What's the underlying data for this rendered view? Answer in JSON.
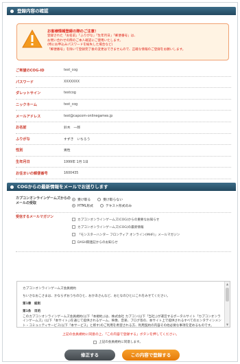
{
  "confirm_section": {
    "title": "登録内容の確認"
  },
  "warning": {
    "title": "お客様情報登録の際のご注意！",
    "lines": [
      "登録された「お名前」「ふりがな」「生年月日」「郵便番号」は、",
      "お問い合わせの際のご本人確認にご使用いたします。",
      "(特にお申込みパスワードを紛失した場合など)",
      "「郵便番号」を除いて登録完了後の変更はできませんので、正確な情報のご登録をお願いします。"
    ]
  },
  "fields": [
    {
      "label": "ご希望のCOG-ID",
      "value": "test_cog"
    },
    {
      "label": "パスワード",
      "value": "XXXXXXX"
    },
    {
      "label": "ダレットサイン",
      "value": "testcog"
    },
    {
      "label": "ニックネーム",
      "value": "test_cog"
    },
    {
      "label": "メールアドレス",
      "value": "test@capcom-onlinegames.jp"
    },
    {
      "label": "お名前",
      "value": "鈴木　一郎"
    },
    {
      "label": "ふりがな",
      "value": "すずき　いちろう"
    },
    {
      "label": "性別",
      "value": "男性"
    },
    {
      "label": "生年月日",
      "value": "1999年 1月 1日"
    },
    {
      "label": "お住まいの郵便番号",
      "value": "1600435"
    }
  ],
  "mail_section": {
    "title": "COGからの最新情報をメールでお送りします",
    "receive": {
      "label": "カプコンオンラインゲームズからのメールの受取",
      "opt_receive": "受け取る",
      "opt_no_receive": "受け取らない",
      "opt_html": "HTML形式",
      "opt_text": "テキスト形式のみ"
    },
    "magazine": {
      "label": "受信するメールマガジン",
      "items": [
        "カプコンオンラインゲームズ(COG)からの重要なお知らせ",
        "カプコンオンラインゲームズ(COG)の最新情報",
        "「モンスターハンター フロンティア オンライン(MHF)」メールマガジン",
        "DASH関連記からのお知らせ"
      ]
    }
  },
  "terms": {
    "title": "カプコンオンラインゲームズ会員規約",
    "intro": "ちいさなおこさまは、かならずおうちのひと、おかあさんなど、おとなのひとにこれをみせてください。",
    "chapter": "第1章　総則",
    "article": "第1条　目的",
    "body": "このカプコンオンラインゲームズ会員規約(以下「本規約」)は、株式会社 カプコン(以下「当社」)が運営するポータルサイト「カプコンオンラインゲームズ」(以下「本サイト」)を通じて提供されるゲーム、映像、音楽、ブログ等の、本サイト上で提供されるすべてのエンタテインメント・コミュニティサービス(以下「本サービス」と称す)のご利用を希望される方、利用契約の内容その他必要な事項を定めるものです。"
  },
  "notice": "上記の会員規約に同意の上、「この内容で登録する」ボタンを押してください。",
  "agree_label": "上記の会員規約に同意します。",
  "buttons": {
    "fix": "修正する",
    "submit": "この内容で登録する"
  }
}
